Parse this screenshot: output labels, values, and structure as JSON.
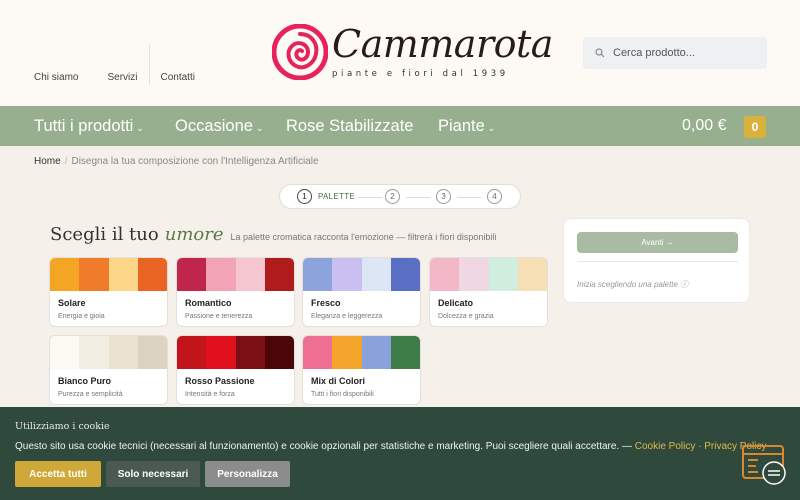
{
  "header": {
    "nav": [
      "Chi siamo",
      "Servizi",
      "Contatti"
    ],
    "logo": {
      "name": "Cammarota",
      "tagline": "piante e fiori dal 1939"
    },
    "search": {
      "placeholder": "Cerca prodotto..."
    }
  },
  "mainnav": {
    "items": [
      {
        "label": "Tutti i prodotti",
        "chevron": "⌄"
      },
      {
        "label": "Occasione",
        "chevron": "⌄"
      },
      {
        "label": "Rose Stabilizzate",
        "chevron": ""
      },
      {
        "label": "Piante",
        "chevron": "⌄"
      }
    ],
    "cart_total": "0,00 €",
    "cart_count": "0"
  },
  "breadcrumb": {
    "home": "Home",
    "separator": "/",
    "current": "Disegna la tua composizione con l'Intelligenza Artificiale"
  },
  "stepper": {
    "steps": [
      "1",
      "2",
      "3",
      "4"
    ],
    "active_label": "PALETTE"
  },
  "heading": {
    "main": "Scegli il tuo",
    "accent": "umore",
    "sub": "La palette cromatica racconta l'emozione — filtrerà i fiori disponibili"
  },
  "palettes": [
    {
      "name": "Solare",
      "desc": "Energia e gioia",
      "colors": [
        "#f4a523",
        "#ef7b2b",
        "#fdd68a",
        "#ea6423"
      ]
    },
    {
      "name": "Romantico",
      "desc": "Passione e tenerezza",
      "colors": [
        "#c0264b",
        "#f2a3b5",
        "#f5c6cf",
        "#b01c1c"
      ]
    },
    {
      "name": "Fresco",
      "desc": "Eleganza e leggerezza",
      "colors": [
        "#8da3dc",
        "#c9bff0",
        "#dce6f4",
        "#5a6fc4"
      ]
    },
    {
      "name": "Delicato",
      "desc": "Dolcezza e grazia",
      "colors": [
        "#f2b8c8",
        "#f0d7e4",
        "#cfeedd",
        "#f6dfb5"
      ]
    },
    {
      "name": "Bianco Puro",
      "desc": "Purezza e semplicità",
      "colors": [
        "#fcf9f3",
        "#f2ede2",
        "#ebe2d2",
        "#dcd3c0"
      ]
    },
    {
      "name": "Rosso Passione",
      "desc": "Intensità e forza",
      "colors": [
        "#c3141c",
        "#e0101c",
        "#7c0e16",
        "#4d0608"
      ]
    },
    {
      "name": "Mix di Colori",
      "desc": "Tutti i fiori disponibili",
      "colors": [
        "#ef6f93",
        "#f3a52b",
        "#8aa1db",
        "#3e7d48"
      ]
    }
  ],
  "side_panel": {
    "next_label": "Avanti →",
    "hint": "Inizia scegliendo una palette ⓘ"
  },
  "cookie": {
    "title": "Utilizziamo i cookie",
    "text": "Questo sito usa cookie tecnici (necessari al funzionamento) e cookie opzionali per statistiche e marketing. Puoi scegliere quali accettare. — ",
    "cookie_policy": "Cookie Policy",
    "sep": " · ",
    "privacy_policy": "Privacy Policy",
    "buttons": {
      "accept": "Accetta tutti",
      "necessary": "Solo necessari",
      "custom": "Personalizza"
    }
  },
  "colors": {
    "nav_green": "#98af8f",
    "cookie_green": "#2f4a3d",
    "gold": "#d8b33c",
    "logo_red": "#e6235a"
  }
}
